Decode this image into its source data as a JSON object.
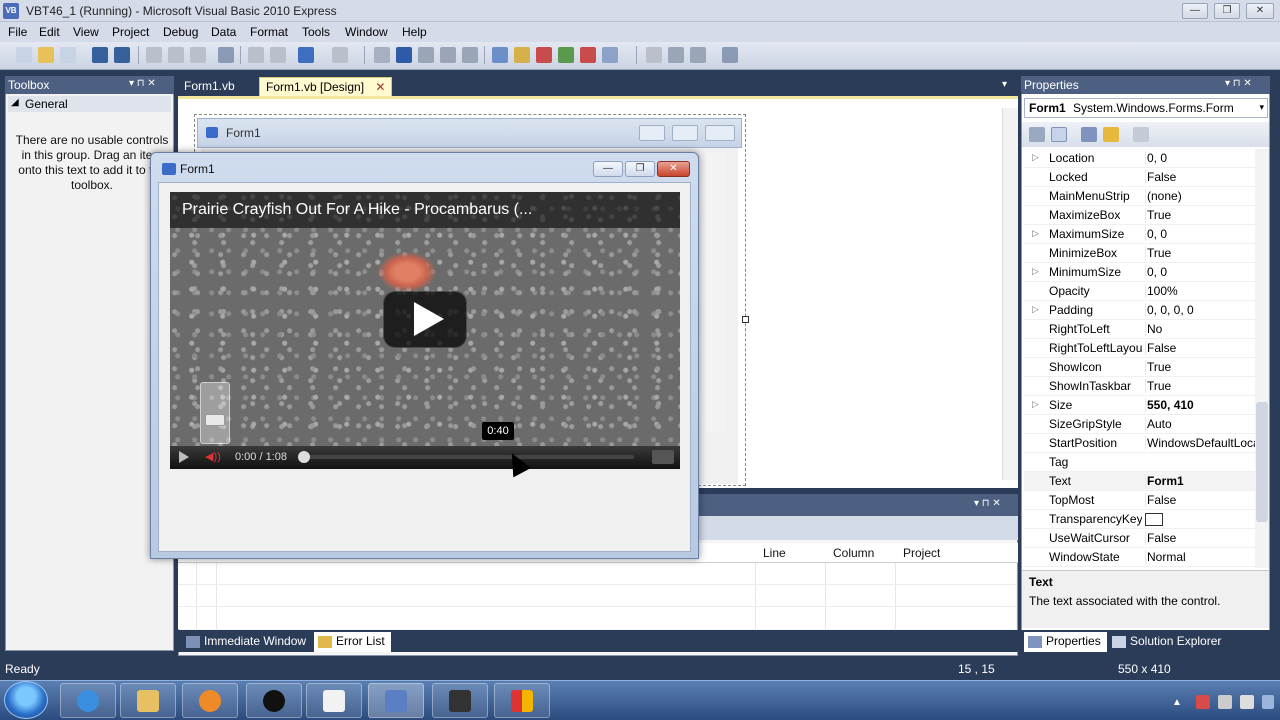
{
  "app": {
    "icon_text": "VB",
    "title": "VBT46_1 (Running) - Microsoft Visual Basic 2010 Express",
    "min_label": "—",
    "max_label": "❐",
    "close_label": "✕"
  },
  "menu": [
    "File",
    "Edit",
    "View",
    "Project",
    "Debug",
    "Data",
    "Format",
    "Tools",
    "Window",
    "Help"
  ],
  "toolbox": {
    "title": "Toolbox",
    "pin_glyph": "▾ ⊓ ✕",
    "group": "General",
    "empty_message": "There are no usable controls in this group. Drag an item onto this text to add it to the toolbox."
  },
  "doc_tabs": {
    "tab1": "Form1.vb",
    "tab2": "Form1.vb [Design]",
    "tab2_close": "✕",
    "overflow": "▾"
  },
  "design_form": {
    "title": "Form1"
  },
  "bottom_panel": {
    "header_glyphs": "▾ ⊓ ✕",
    "columns": [
      "Line",
      "Column",
      "Project"
    ],
    "tabs": {
      "immediate": "Immediate Window",
      "errors": "Error List"
    }
  },
  "properties": {
    "title": "Properties",
    "header_glyphs": "▾ ⊓ ✕",
    "object_name": "Form1",
    "object_type": "System.Windows.Forms.Form",
    "rows": [
      {
        "name": "Location",
        "value": "0, 0",
        "expander": "▷",
        "bold": false
      },
      {
        "name": "Locked",
        "value": "False",
        "expander": "",
        "bold": false
      },
      {
        "name": "MainMenuStrip",
        "value": "(none)",
        "expander": "",
        "bold": false
      },
      {
        "name": "MaximizeBox",
        "value": "True",
        "expander": "",
        "bold": false
      },
      {
        "name": "MaximumSize",
        "value": "0, 0",
        "expander": "▷",
        "bold": false
      },
      {
        "name": "MinimizeBox",
        "value": "True",
        "expander": "",
        "bold": false
      },
      {
        "name": "MinimumSize",
        "value": "0, 0",
        "expander": "▷",
        "bold": false
      },
      {
        "name": "Opacity",
        "value": "100%",
        "expander": "",
        "bold": false
      },
      {
        "name": "Padding",
        "value": "0, 0, 0, 0",
        "expander": "▷",
        "bold": false
      },
      {
        "name": "RightToLeft",
        "value": "No",
        "expander": "",
        "bold": false
      },
      {
        "name": "RightToLeftLayout",
        "value": "False",
        "expander": "",
        "bold": false
      },
      {
        "name": "ShowIcon",
        "value": "True",
        "expander": "",
        "bold": false
      },
      {
        "name": "ShowInTaskbar",
        "value": "True",
        "expander": "",
        "bold": false
      },
      {
        "name": "Size",
        "value": "550, 410",
        "expander": "▷",
        "bold": true
      },
      {
        "name": "SizeGripStyle",
        "value": "Auto",
        "expander": "",
        "bold": false
      },
      {
        "name": "StartPosition",
        "value": "WindowsDefaultLocation",
        "expander": "",
        "bold": false
      },
      {
        "name": "Tag",
        "value": "",
        "expander": "",
        "bold": false
      },
      {
        "name": "Text",
        "value": "Form1",
        "expander": "",
        "bold": true
      },
      {
        "name": "TopMost",
        "value": "False",
        "expander": "",
        "bold": false
      },
      {
        "name": "TransparencyKey",
        "value": "",
        "expander": "",
        "bold": false
      },
      {
        "name": "UseWaitCursor",
        "value": "False",
        "expander": "",
        "bold": false
      },
      {
        "name": "WindowState",
        "value": "Normal",
        "expander": "",
        "bold": false
      }
    ],
    "description_title": "Text",
    "description_text": "The text associated with the control.",
    "tabs": {
      "properties": "Properties",
      "solution": "Solution Explorer"
    }
  },
  "run_window": {
    "title": "Form1",
    "min": "—",
    "max": "❐",
    "close": "✕"
  },
  "video": {
    "title": "Prairie Crayfish Out For A Hike - Procambarus (...",
    "time": "0:00 / 1:08",
    "tooltip": "0:40",
    "volume_glyph": "◀))"
  },
  "status": {
    "ready": "Ready",
    "position": "15 , 15",
    "size": "550 x 410"
  },
  "colors": {
    "accent_panel": "#4d6082",
    "ide_background": "#2b3c59",
    "design_tab": "#fffad0"
  }
}
